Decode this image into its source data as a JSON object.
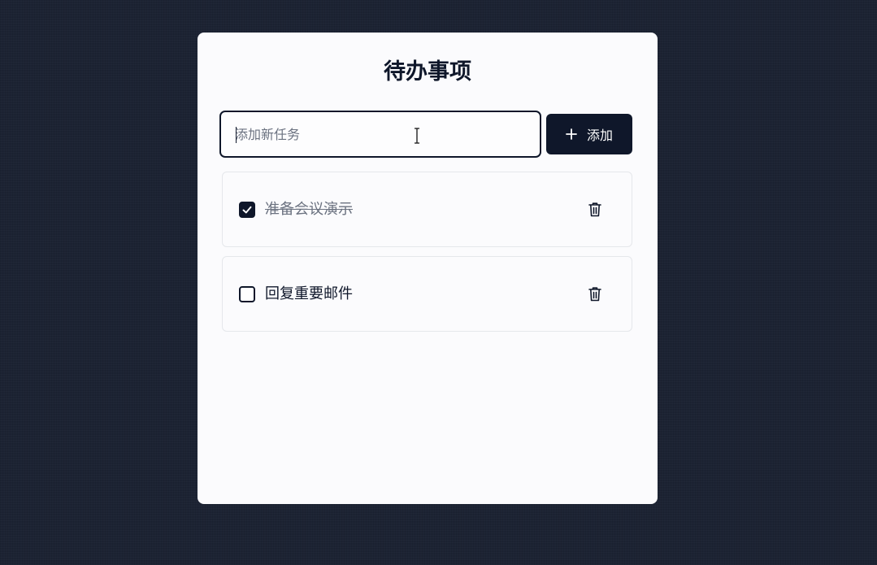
{
  "header": {
    "title": "待办事项"
  },
  "new_task": {
    "placeholder": "添加新任务",
    "value": ""
  },
  "add_button": {
    "label": "添加",
    "icon": "plus-icon"
  },
  "tasks": [
    {
      "label": "准备会议演示",
      "completed": true
    },
    {
      "label": "回复重要邮件",
      "completed": false
    }
  ],
  "colors": {
    "background": "#1c2333",
    "card": "#fbfbfd",
    "primary": "#0f172a",
    "muted_text": "#6b7280",
    "border": "#e5e7eb"
  }
}
